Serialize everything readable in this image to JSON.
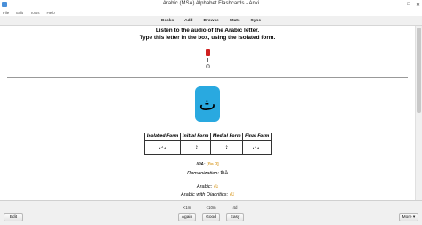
{
  "window": {
    "title": "Arabic (MSA) Alphabet Flashcards - Anki",
    "controls": {
      "minimize": "—",
      "maximize": "□",
      "close": "✕"
    }
  },
  "menu": [
    "File",
    "Edit",
    "Tools",
    "Help"
  ],
  "toolbar": [
    "Decks",
    "Add",
    "Browse",
    "Stats",
    "Sync"
  ],
  "card": {
    "prompt_line1": "Listen to the audio of the Arabic letter.",
    "prompt_line2": "Type this letter in the box, using the isolated form.",
    "letter": "ث",
    "table_headers": [
      "Isolated Form",
      "Initial Form",
      "Medial Form",
      "Final Form"
    ],
    "table_values": [
      "ث",
      "ثـ",
      "ـثـ",
      "ـث"
    ],
    "ipa_label": "IPA:",
    "ipa_value": "[θa ʔ]",
    "romanization_label": "Romanization:",
    "romanization_value": "thā",
    "arabic_label": "Arabic:",
    "arabic_value": "ثاء",
    "diacritics_label": "Arabic with Diacritics:",
    "diacritics_value": "ثَاء"
  },
  "answer_bar": {
    "edit": "Edit",
    "more": "More ▾",
    "buttons": [
      {
        "interval": "<1m",
        "label": "Again"
      },
      {
        "interval": "<10m",
        "label": "Good"
      },
      {
        "interval": "4d",
        "label": "Easy"
      }
    ]
  }
}
